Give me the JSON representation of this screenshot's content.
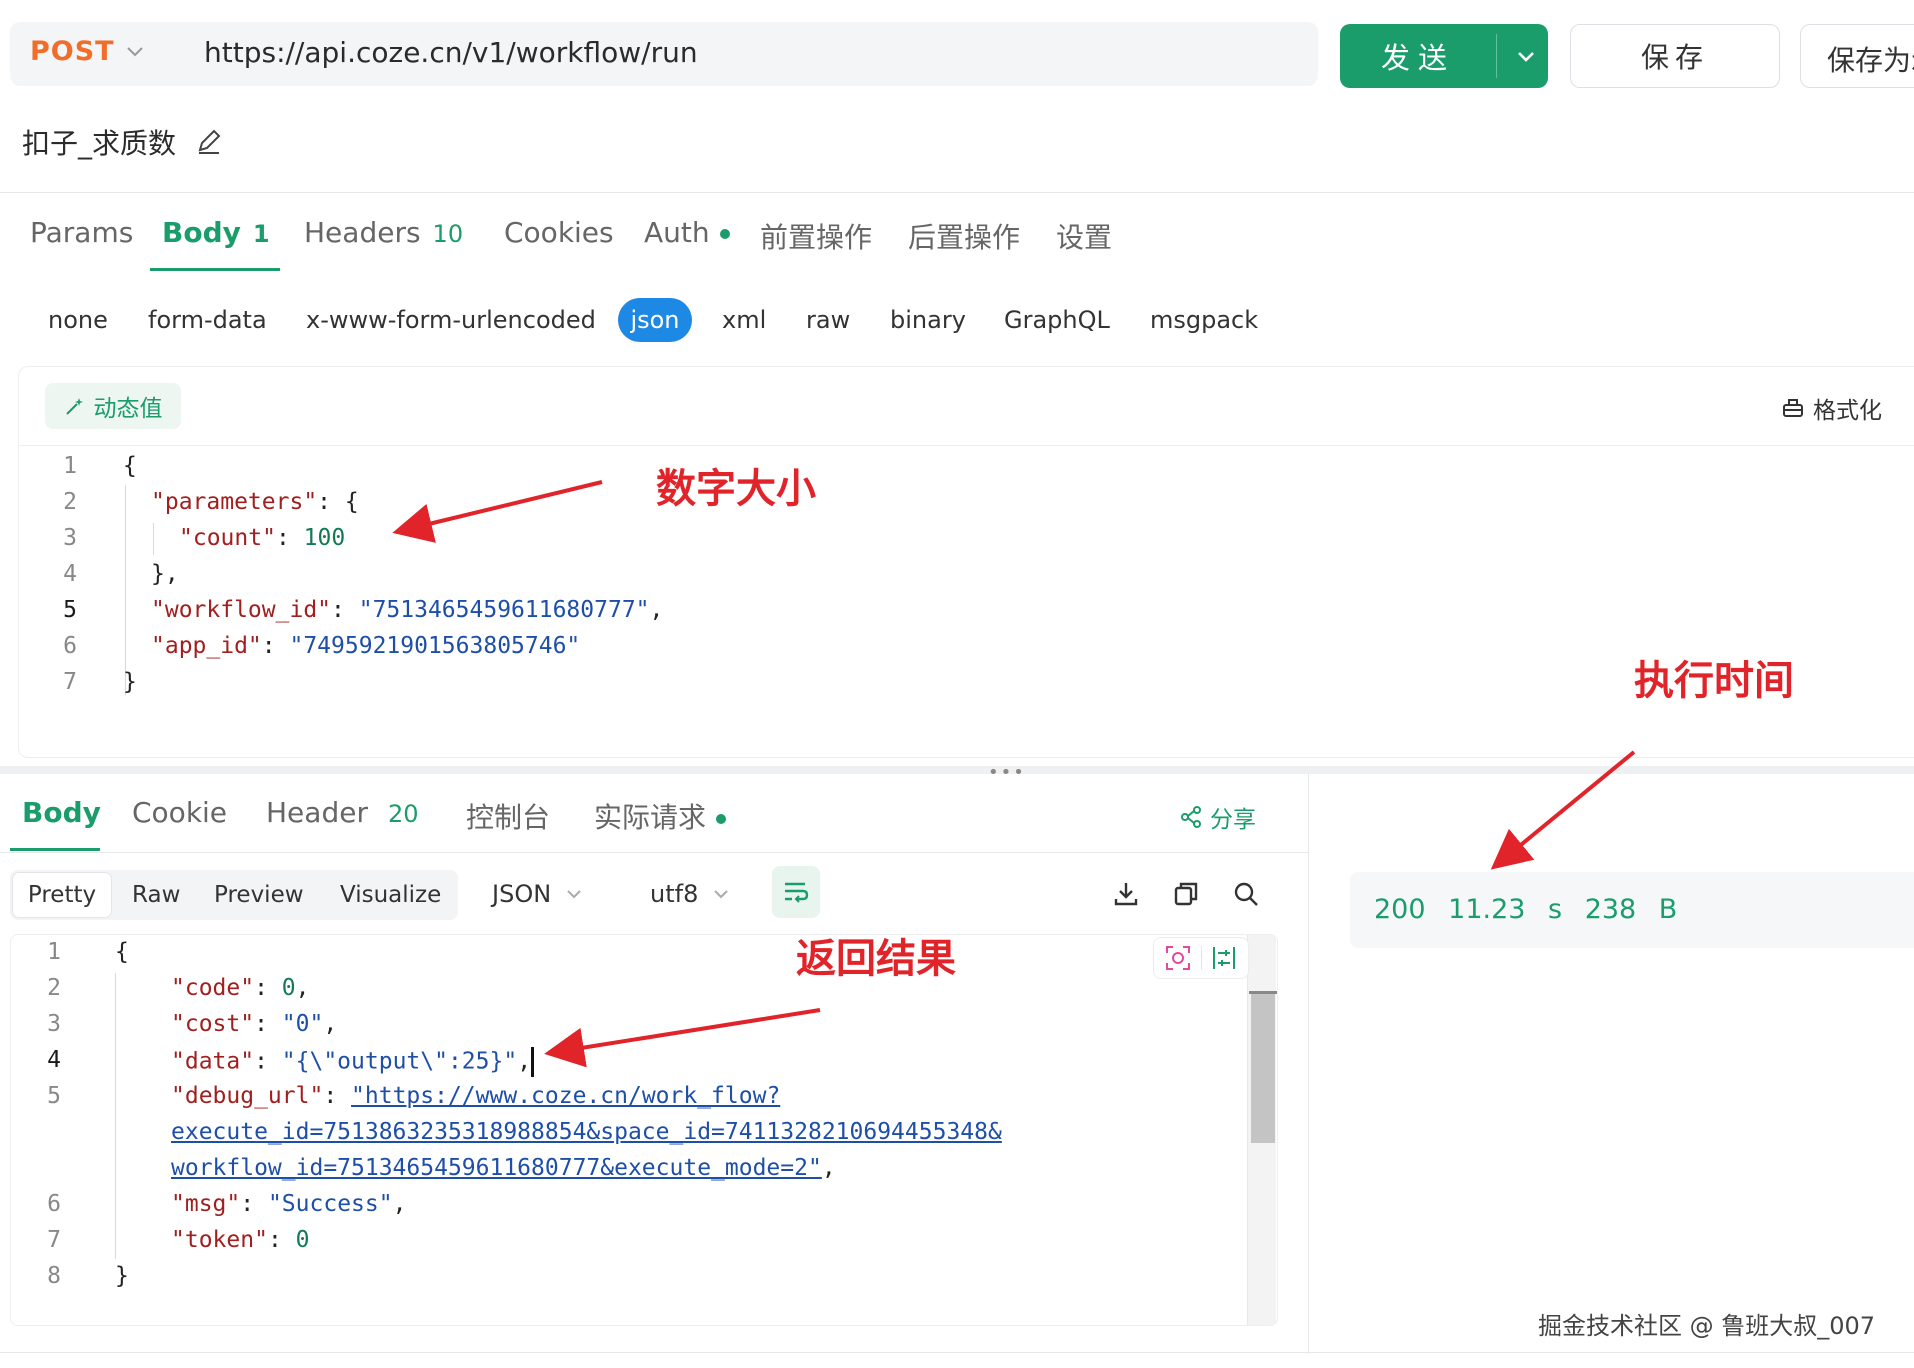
{
  "request": {
    "method": "POST",
    "url": "https://api.coze.cn/v1/workflow/run",
    "send_label": "发送",
    "save_label": "保存",
    "save_as_label": "保存为示例",
    "name": "扣子_求质数"
  },
  "request_tabs": [
    {
      "label": "Params",
      "count": ""
    },
    {
      "label": "Body",
      "count": "1"
    },
    {
      "label": "Headers",
      "count": "10"
    },
    {
      "label": "Cookies",
      "count": ""
    },
    {
      "label": "Auth",
      "count": ""
    },
    {
      "label": "前置操作",
      "count": ""
    },
    {
      "label": "后置操作",
      "count": ""
    },
    {
      "label": "设置",
      "count": ""
    }
  ],
  "body_types": [
    "none",
    "form-data",
    "x-www-form-urlencoded",
    "json",
    "xml",
    "raw",
    "binary",
    "GraphQL",
    "msgpack"
  ],
  "selected_body_type": "json",
  "editor_toolbar": {
    "dynamic_value": "动态值",
    "format": "格式化"
  },
  "request_body": {
    "line_numbers": [
      "1",
      "2",
      "3",
      "4",
      "5",
      "6",
      "7"
    ],
    "key_parameters": "\"parameters\"",
    "key_count": "\"count\"",
    "count_value": "100",
    "key_workflow_id": "\"workflow_id\"",
    "workflow_id": "\"7513465459611680777\"",
    "key_app_id": "\"app_id\"",
    "app_id": "\"7495921901563805746\""
  },
  "response_tabs": [
    {
      "label": "Body",
      "count": ""
    },
    {
      "label": "Cookie",
      "count": ""
    },
    {
      "label": "Header",
      "count": "20"
    },
    {
      "label": "控制台",
      "count": ""
    },
    {
      "label": "实际请求",
      "count": ""
    }
  ],
  "share_label": "分享",
  "view_modes": [
    "Pretty",
    "Raw",
    "Preview",
    "Visualize"
  ],
  "format_select": "JSON",
  "encoding_select": "utf8",
  "response_body": {
    "line_numbers": [
      "1",
      "2",
      "3",
      "4",
      "5",
      "6",
      "7",
      "8"
    ],
    "key_code": "\"code\"",
    "code": "0",
    "key_cost": "\"cost\"",
    "cost": "\"0\"",
    "key_data": "\"data\"",
    "data": "\"{\\\"output\\\":25}\"",
    "key_debug_url": "\"debug_url\"",
    "debug_url_line1": "\"https://www.coze.cn/work_flow?",
    "debug_url_line2": "execute_id=7513863235318988854&space_id=7411328210694455348&",
    "debug_url_line3": "workflow_id=7513465459611680777&execute_mode=2\"",
    "key_msg": "\"msg\"",
    "msg": "\"Success\"",
    "key_token": "\"token\"",
    "token": "0"
  },
  "status": {
    "code": "200",
    "time": "11.23 s",
    "size": "238 B"
  },
  "annotations": {
    "number_size": "数字大小",
    "exec_time": "执行时间",
    "result": "返回结果"
  },
  "watermark": "掘金技术社区 @ 鲁班大叔_007",
  "colors": {
    "accent": "#1a9c6b",
    "method": "#f06d2a",
    "json_pill": "#1e88e5",
    "annotation": "#e0242a"
  }
}
